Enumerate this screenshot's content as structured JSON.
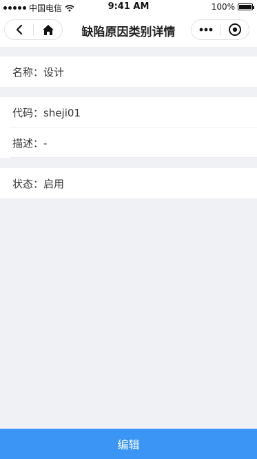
{
  "status": {
    "carrier": "中国电信",
    "time": "9:41 AM",
    "battery": "100%"
  },
  "nav": {
    "title": "缺陷原因类别详情"
  },
  "details": {
    "name": "名称：设计",
    "code": "代码：sheji01",
    "description": "描述：-",
    "state": "状态：启用"
  },
  "footer": {
    "edit_label": "编辑"
  },
  "colors": {
    "accent": "#3a95f5",
    "background": "#f0f1f5"
  }
}
